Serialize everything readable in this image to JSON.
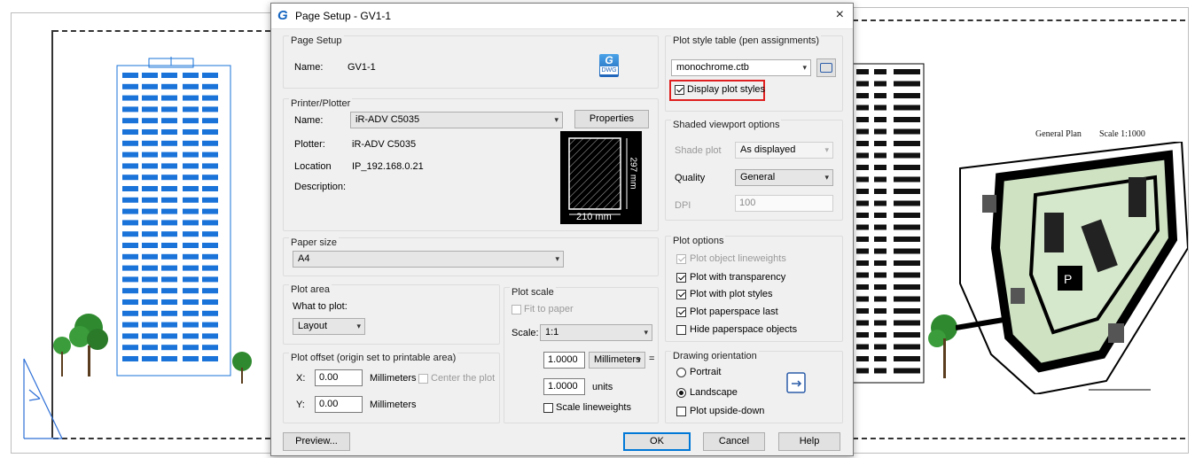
{
  "window": {
    "title": "Page Setup - GV1-1",
    "close_glyph": "×"
  },
  "page_setup": {
    "group_label": "Page Setup",
    "name_label": "Name:",
    "name_value": "GV1-1",
    "dwg_icon_text": "DWG"
  },
  "printer": {
    "group_label": "Printer/Plotter",
    "name_label": "Name:",
    "name_value": "iR-ADV C5035",
    "properties_label": "Properties",
    "plotter_label": "Plotter:",
    "plotter_value": "iR-ADV C5035",
    "location_label": "Location",
    "location_value": "IP_192.168.0.21",
    "description_label": "Description:",
    "preview_width": "210 mm",
    "preview_height": "297 mm"
  },
  "paper_size": {
    "group_label": "Paper size",
    "value": "A4"
  },
  "plot_area": {
    "group_label": "Plot area",
    "what_label": "What to plot:",
    "what_value": "Layout"
  },
  "plot_offset": {
    "group_label": "Plot offset (origin set to printable area)",
    "x_label": "X:",
    "x_value": "0.00",
    "x_unit": "Millimeters",
    "center_label": "Center the plot",
    "y_label": "Y:",
    "y_value": "0.00",
    "y_unit": "Millimeters"
  },
  "plot_scale": {
    "group_label": "Plot scale",
    "fit_label": "Fit to paper",
    "scale_label": "Scale:",
    "scale_value": "1:1",
    "value1": "1.0000",
    "unit1": "Millimeters",
    "eq_glyph": "=",
    "value2": "1.0000",
    "unit2": "units",
    "lineweights_label": "Scale lineweights"
  },
  "plot_style": {
    "group_label": "Plot style table (pen assignments)",
    "value": "monochrome.ctb",
    "display_label": "Display plot styles"
  },
  "shaded": {
    "group_label": "Shaded viewport options",
    "shade_label": "Shade plot",
    "shade_value": "As displayed",
    "quality_label": "Quality",
    "quality_value": "General",
    "dpi_label": "DPI",
    "dpi_value": "100"
  },
  "plot_options": {
    "group_label": "Plot options",
    "items": [
      {
        "label": "Plot object lineweights"
      },
      {
        "label": "Plot with transparency"
      },
      {
        "label": "Plot with plot styles"
      },
      {
        "label": "Plot paperspace last"
      },
      {
        "label": "Hide paperspace objects"
      }
    ]
  },
  "orientation": {
    "group_label": "Drawing orientation",
    "portrait_label": "Portrait",
    "landscape_label": "Landscape",
    "upside_label": "Plot upside-down"
  },
  "buttons": {
    "preview": "Preview...",
    "ok": "OK",
    "cancel": "Cancel",
    "help": "Help"
  },
  "background": {
    "plan_title": "General Plan",
    "plan_scale": "Scale 1:1000"
  },
  "colors": {
    "accent": "#0078d7",
    "highlight": "#e02020",
    "building_blue": "#1a73d9"
  }
}
